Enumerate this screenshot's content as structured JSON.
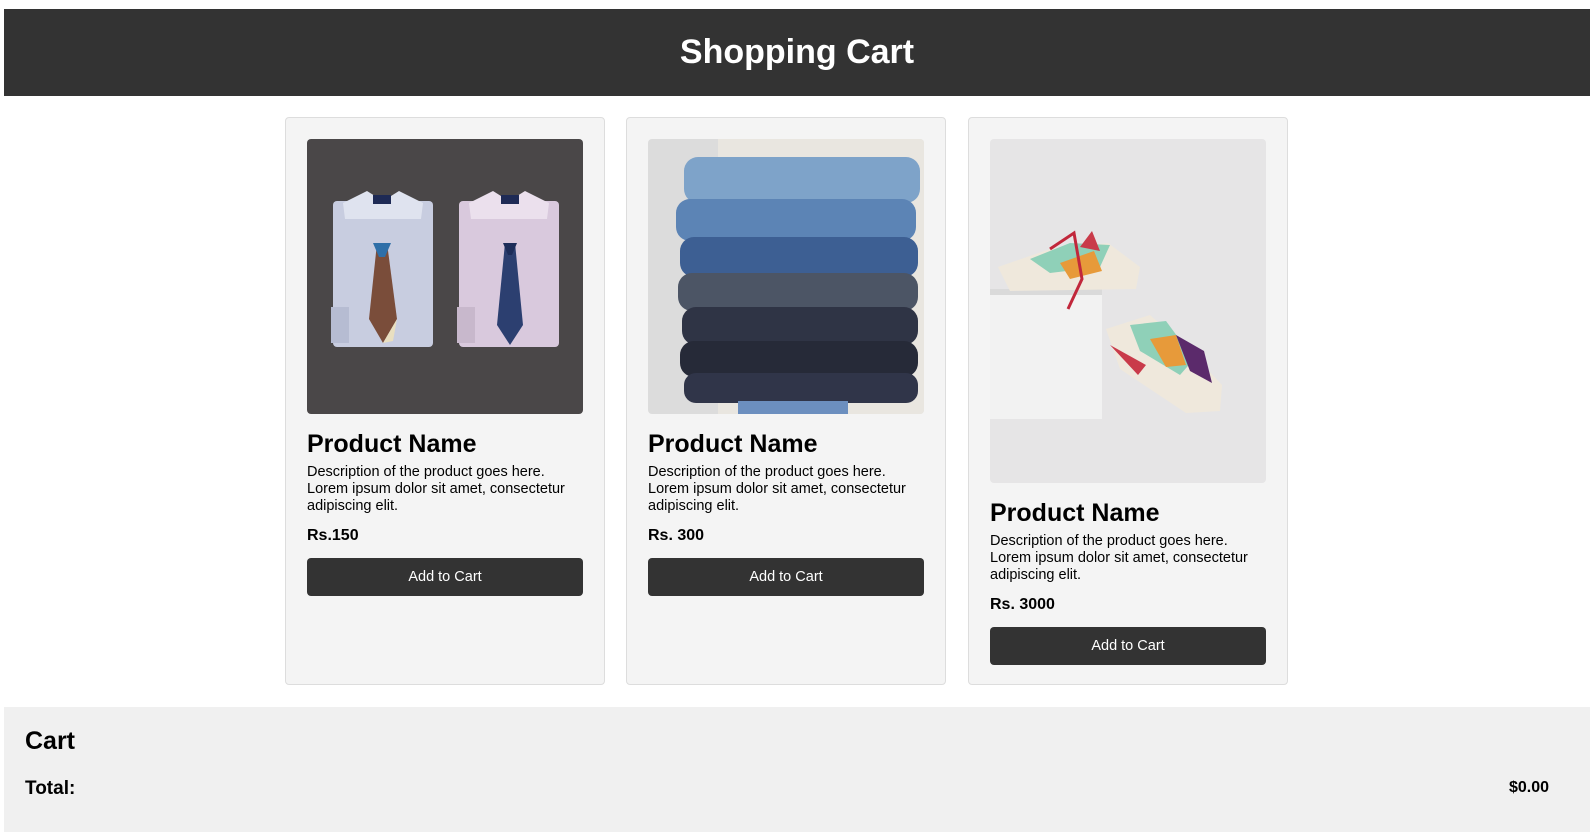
{
  "header": {
    "title": "Shopping Cart"
  },
  "products": [
    {
      "name": "Product Name",
      "description": "Description of the product goes here. Lorem ipsum dolor sit amet, consectetur adipiscing elit.",
      "price": "Rs.150",
      "button": "Add to Cart",
      "image": "shirts-with-ties"
    },
    {
      "name": "Product Name",
      "description": "Description of the product goes here. Lorem ipsum dolor sit amet, consectetur adipiscing elit.",
      "price": "Rs. 300",
      "button": "Add to Cart",
      "image": "stack-of-jeans"
    },
    {
      "name": "Product Name",
      "description": "Description of the product goes here. Lorem ipsum dolor sit amet, consectetur adipiscing elit.",
      "price": "Rs. 3000",
      "button": "Add to Cart",
      "image": "sneakers"
    }
  ],
  "cart": {
    "title": "Cart",
    "total_label": "Total:",
    "total_value": "$0.00"
  },
  "colors": {
    "header_bg": "#333333",
    "button_bg": "#333333",
    "card_bg": "#f4f4f4",
    "cart_bg": "#f0f0f0"
  }
}
